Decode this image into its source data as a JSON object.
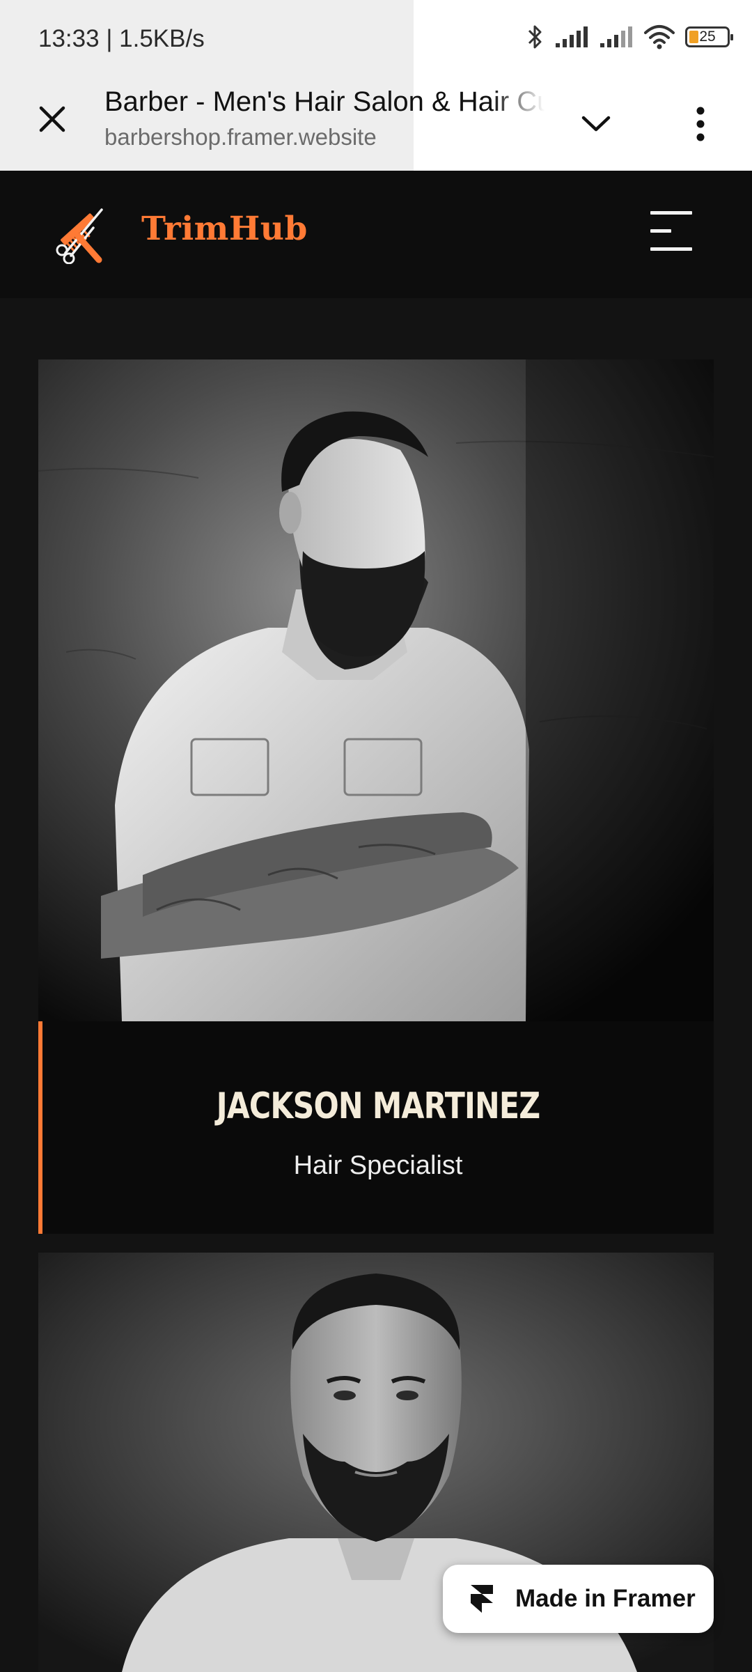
{
  "status_bar": {
    "time": "13:33",
    "network_speed": "1.5KB/s",
    "battery_level": "25",
    "icons": [
      "bluetooth-icon",
      "signal-icon",
      "signal-icon",
      "wifi-icon",
      "battery-icon"
    ]
  },
  "browser": {
    "page_title": "Barber - Men's Hair Salon & Hair Cut",
    "url": "barbershop.framer.website",
    "close_icon": "close-icon",
    "tabs_icon": "chevron-down-icon",
    "menu_icon": "more-vertical-icon"
  },
  "site_header": {
    "brand_name": "TrimHub",
    "logo_icon": "comb-scissors-icon",
    "menu_icon": "hamburger-menu-icon"
  },
  "team": [
    {
      "name": "JACKSON MARTINEZ",
      "role": "Hair Specialist",
      "photo": "bearded-man-arms-crossed"
    },
    {
      "name": "",
      "role": "",
      "photo": "bearded-man-portrait"
    }
  ],
  "framer_badge": {
    "label": "Made in Framer",
    "icon": "framer-logo-icon"
  },
  "colors": {
    "accent": "#ff7a35",
    "header_bg": "#0d0d0d",
    "page_bg": "#131313",
    "card_info_bg": "#0a0a0a",
    "name_text": "#f4ecda",
    "battery_fill": "#f0a024"
  }
}
